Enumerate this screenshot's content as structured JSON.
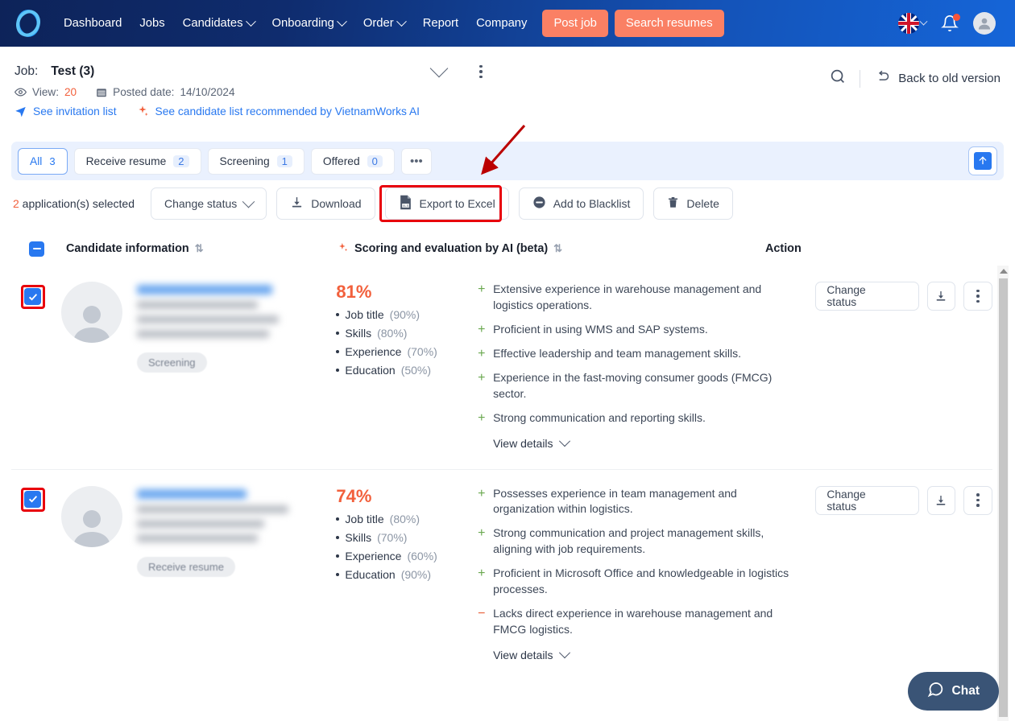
{
  "nav": {
    "logo_icon": "vietnamworks-logo-icon",
    "links": [
      {
        "label": "Dashboard",
        "has_caret": false
      },
      {
        "label": "Jobs",
        "has_caret": false
      },
      {
        "label": "Candidates",
        "has_caret": true
      },
      {
        "label": "Onboarding",
        "has_caret": true
      },
      {
        "label": "Order",
        "has_caret": true
      },
      {
        "label": "Report",
        "has_caret": false
      },
      {
        "label": "Company",
        "has_caret": false
      }
    ],
    "cta_post_job": "Post job",
    "cta_search_resumes": "Search resumes",
    "flag_icon": "uk-flag-icon",
    "bell_icon": "notification-bell-icon",
    "avatar_icon": "user-avatar-icon",
    "accent_orange": "#fa8064"
  },
  "job": {
    "label": "Job:",
    "name": "Test (3)",
    "view_label": "View:",
    "view_count": "20",
    "posted_label": "Posted date:",
    "posted_date": "14/10/2024",
    "invitation_link": "See invitation list",
    "ai_link": "See candidate list recommended by VietnamWorks AI",
    "back_to_old": "Back to old version",
    "search_icon": "search-icon",
    "chevron_icon": "chevron-down-icon",
    "kebab_icon": "more-vertical-icon"
  },
  "tabs": {
    "items": [
      {
        "label": "All",
        "count": "3",
        "active": true
      },
      {
        "label": "Receive resume",
        "count": "2",
        "active": false
      },
      {
        "label": "Screening",
        "count": "1",
        "active": false
      },
      {
        "label": "Offered",
        "count": "0",
        "active": false
      }
    ],
    "more_label": "•••",
    "upload_icon": "upload-icon"
  },
  "toolbar": {
    "selected_count": "2",
    "selected_text": " application(s) selected",
    "buttons": [
      {
        "label": "Change status",
        "icon": "chevron-down-icon"
      },
      {
        "label": "Download",
        "icon": "download-icon"
      },
      {
        "label": "Export to Excel",
        "icon": "excel-file-icon"
      },
      {
        "label": "Add to Blacklist",
        "icon": "block-icon"
      },
      {
        "label": "Delete",
        "icon": "trash-icon"
      }
    ],
    "highlight_color": "#e8000b"
  },
  "columns": {
    "candidate": "Candidate information",
    "scoring": "Scoring and evaluation by AI (beta)",
    "action": "Action",
    "sort_icon": "sort-arrows-icon",
    "sparkle_icon": "ai-sparkle-icon"
  },
  "rows": [
    {
      "checked": true,
      "status_chip": "Screening",
      "score": "81%",
      "breakdown": [
        {
          "label": "Job title",
          "value": "(90%)"
        },
        {
          "label": "Skills",
          "value": "(80%)"
        },
        {
          "label": "Experience",
          "value": "(70%)"
        },
        {
          "label": "Education",
          "value": "(50%)"
        }
      ],
      "evaluation": [
        {
          "sign": "+",
          "text": "Extensive experience in warehouse management and logistics operations."
        },
        {
          "sign": "+",
          "text": "Proficient in using WMS and SAP systems."
        },
        {
          "sign": "+",
          "text": "Effective leadership and team management skills."
        },
        {
          "sign": "+",
          "text": "Experience in the fast-moving consumer goods (FMCG) sector."
        },
        {
          "sign": "+",
          "text": "Strong communication and reporting skills."
        }
      ],
      "view_details": "View details",
      "action_label": "Change status"
    },
    {
      "checked": true,
      "status_chip": "Receive resume",
      "score": "74%",
      "breakdown": [
        {
          "label": "Job title",
          "value": "(80%)"
        },
        {
          "label": "Skills",
          "value": "(70%)"
        },
        {
          "label": "Experience",
          "value": "(60%)"
        },
        {
          "label": "Education",
          "value": "(90%)"
        }
      ],
      "evaluation": [
        {
          "sign": "+",
          "text": "Possesses experience in team management and organization within logistics."
        },
        {
          "sign": "+",
          "text": "Strong communication and project management skills, aligning with job requirements."
        },
        {
          "sign": "+",
          "text": "Proficient in Microsoft Office and knowledgeable in logistics processes."
        },
        {
          "sign": "−",
          "text": "Lacks direct experience in warehouse management and FMCG logistics."
        }
      ],
      "view_details": "View details",
      "action_label": "Change status"
    }
  ],
  "chat": {
    "label": "Chat",
    "icon": "chat-bubble-icon",
    "color": "#3a5476"
  }
}
